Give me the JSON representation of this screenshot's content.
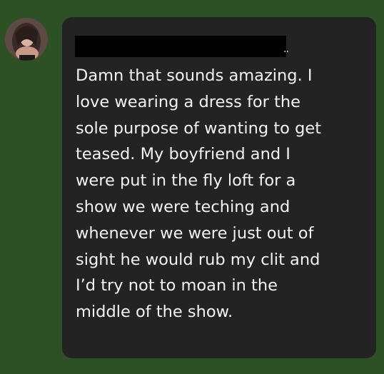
{
  "colors": {
    "background": "#2e5025",
    "bubble": "#232323",
    "text": "#f2f2f2",
    "redaction": "#000000"
  },
  "sender": {
    "avatar_icon": "avatar-photo",
    "name_redacted": true,
    "name_suffix": ".."
  },
  "message": {
    "text": "Damn that sounds amazing. I\nlove wearing a dress for the\nsole purpose of wanting to get\nteased. My boyfriend and I\nwere put in the fly loft for a\nshow we were teching and\nwhenever we were just out of\nsight he would rub my clit and\nI’d try not to moan in the\nmiddle of the show."
  }
}
